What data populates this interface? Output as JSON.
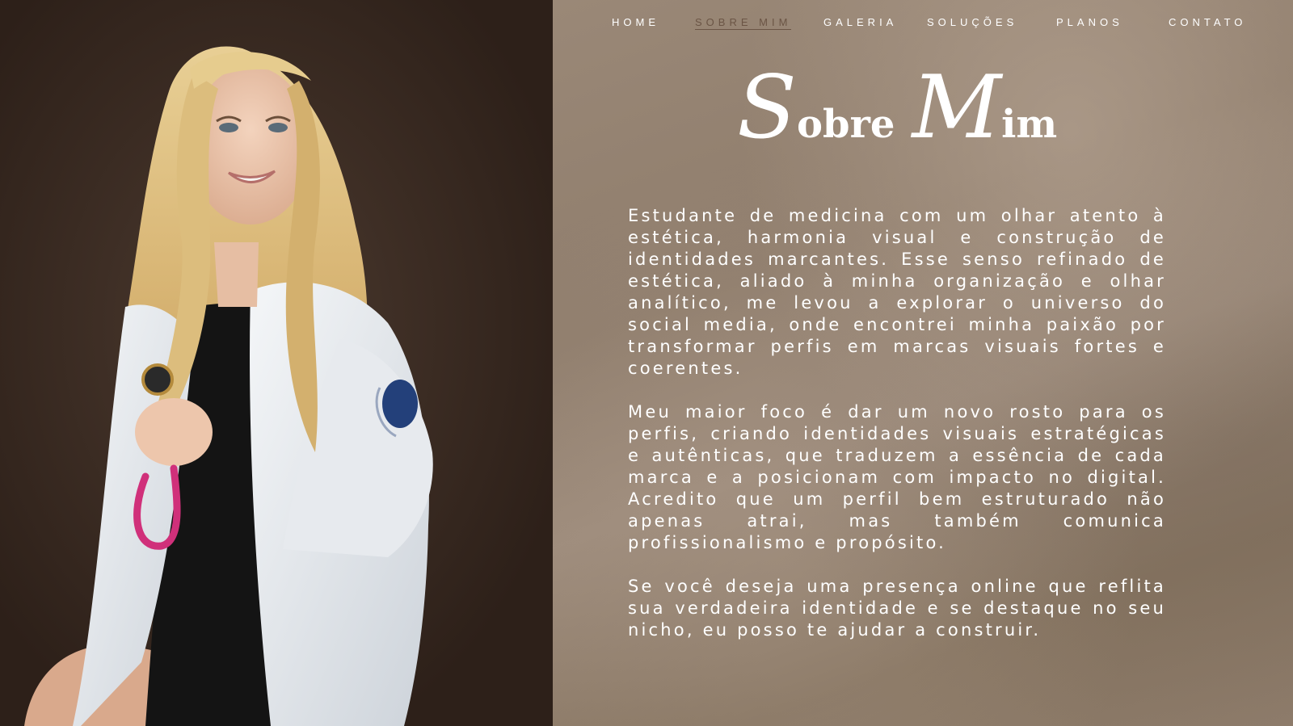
{
  "nav": {
    "items": [
      {
        "label": "HOME"
      },
      {
        "label": "SOBRE MIM"
      },
      {
        "label": "GALERIA"
      },
      {
        "label": "SOLUÇÕES"
      },
      {
        "label": "PLANOS"
      },
      {
        "label": "CONTATO"
      }
    ],
    "active": "SOBRE MIM"
  },
  "title": {
    "cap1": "S",
    "rest1": "obre",
    "cap2": "M",
    "rest2": "im"
  },
  "about": {
    "paragraphs": [
      "Estudante de medicina com um olhar atento à estética, harmonia visual e construção de identidades marcantes. Esse senso refinado de estética, aliado à minha organização e olhar analítico, me levou a explorar o universo do social media, onde encontrei minha paixão por transformar perfis em marcas visuais fortes e coerentes.",
      "Meu maior foco é dar um novo rosto para os perfis, criando identidades visuais estratégicas e autênticas, que traduzem a essência de cada marca e a posicionam com impacto no digital. Acredito que um perfil bem estruturado  não apenas atrai, mas também comunica profissionalismo e propósito.",
      "Se você deseja uma presença online que reflita sua verdadeira identidade e se destaque no seu nicho, eu posso te ajudar a construir."
    ]
  },
  "colors": {
    "left_background": "#3a2a22",
    "right_background": "#8f7f70",
    "text": "#ffffff",
    "nav_active": "#6b5545"
  }
}
